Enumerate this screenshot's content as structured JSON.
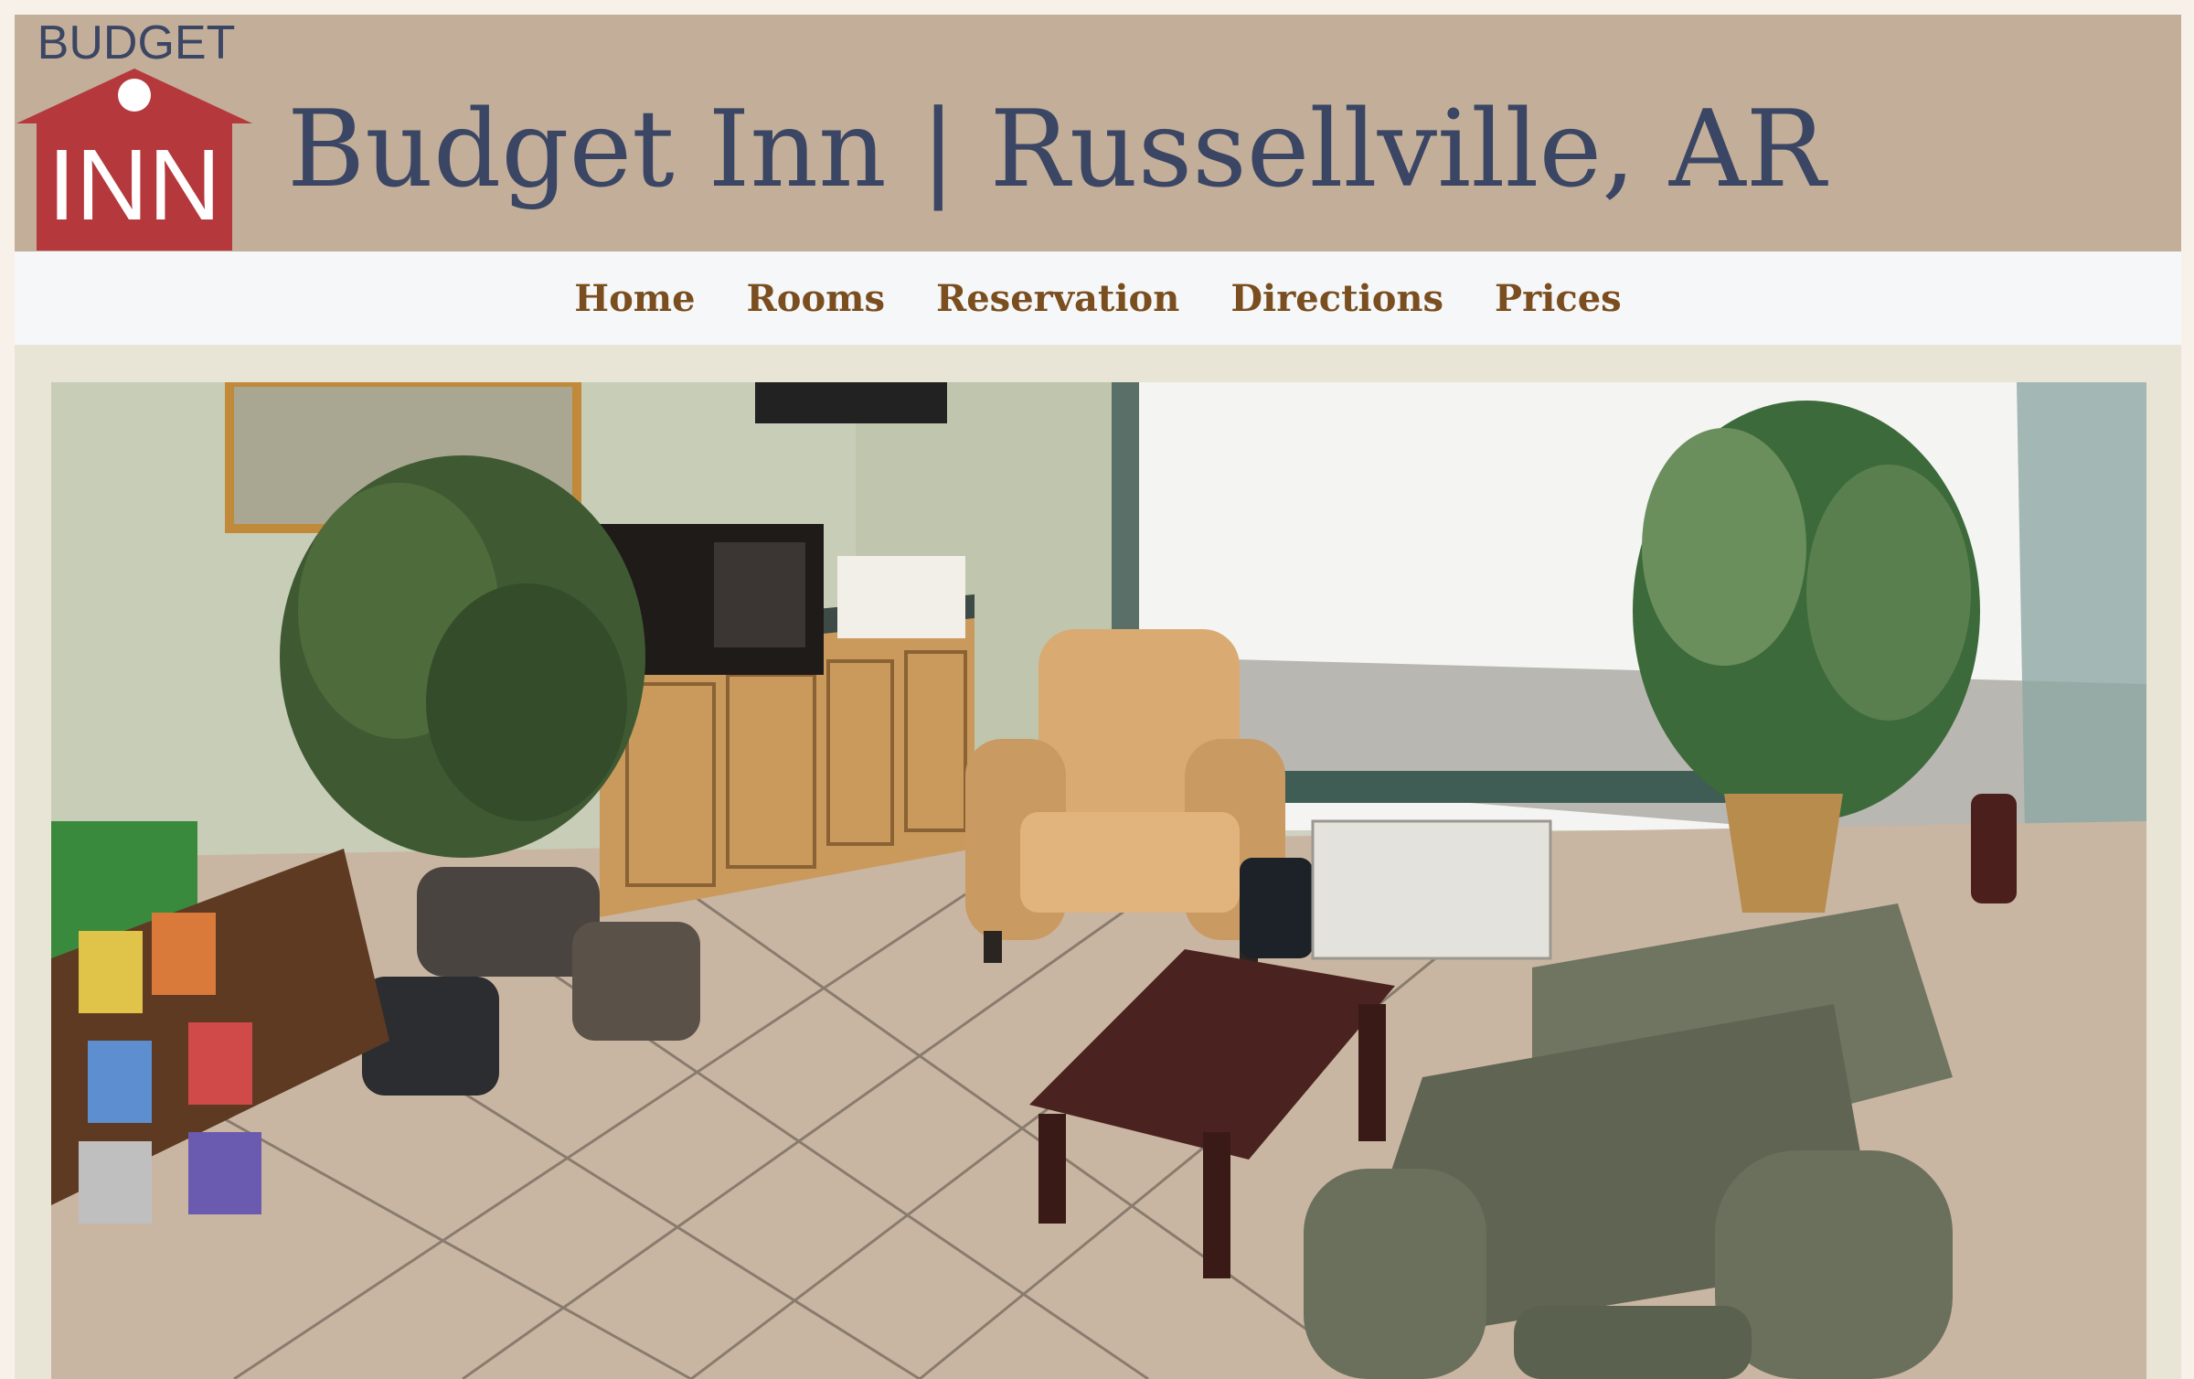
{
  "header": {
    "logo": {
      "top_text": "BUDGET",
      "main_text": "INN",
      "icon": "house-logo-icon",
      "brand_color": "#b5383c"
    },
    "title": "Budget Inn | Russellville, AR",
    "background_color": "#c3ae99",
    "title_color": "#3a4663"
  },
  "nav": {
    "items": [
      {
        "label": "Home"
      },
      {
        "label": "Rooms"
      },
      {
        "label": "Reservation"
      },
      {
        "label": "Directions"
      },
      {
        "label": "Prices"
      }
    ],
    "link_color": "#7a4e1e"
  },
  "hero": {
    "image": "lobby-photo"
  }
}
